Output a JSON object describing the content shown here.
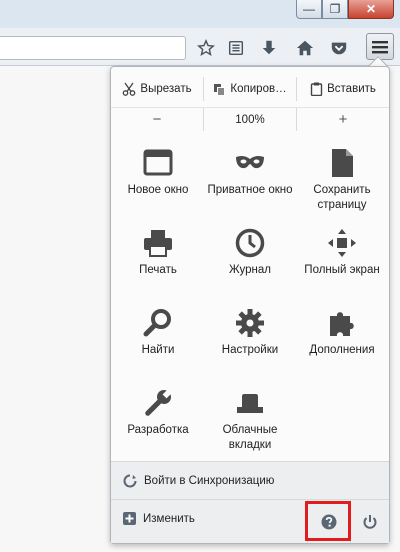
{
  "window": {
    "min_glyph": "—",
    "max_glyph": "❐",
    "close_glyph": "✕"
  },
  "panel": {
    "edit": {
      "cut": "Вырезать",
      "copy": "Копиров…",
      "paste": "Вставить"
    },
    "zoom": {
      "minus": "−",
      "value": "100%",
      "plus": "+"
    },
    "tiles": {
      "new_window": "Новое окно",
      "private_window": "Приватное окно",
      "save_page": "Сохранить страницу",
      "print": "Печать",
      "history": "Журнал",
      "fullscreen": "Полный экран",
      "find": "Найти",
      "options": "Настройки",
      "addons": "Дополнения",
      "developer": "Разработка",
      "cloud_tabs": "Облачные вкладки"
    },
    "sync": "Войти в Синхронизацию",
    "customize": "Изменить"
  },
  "colors": {
    "icon": "#4a4a4a",
    "highlight": "#e01c1c",
    "accent": "#5a6673"
  }
}
